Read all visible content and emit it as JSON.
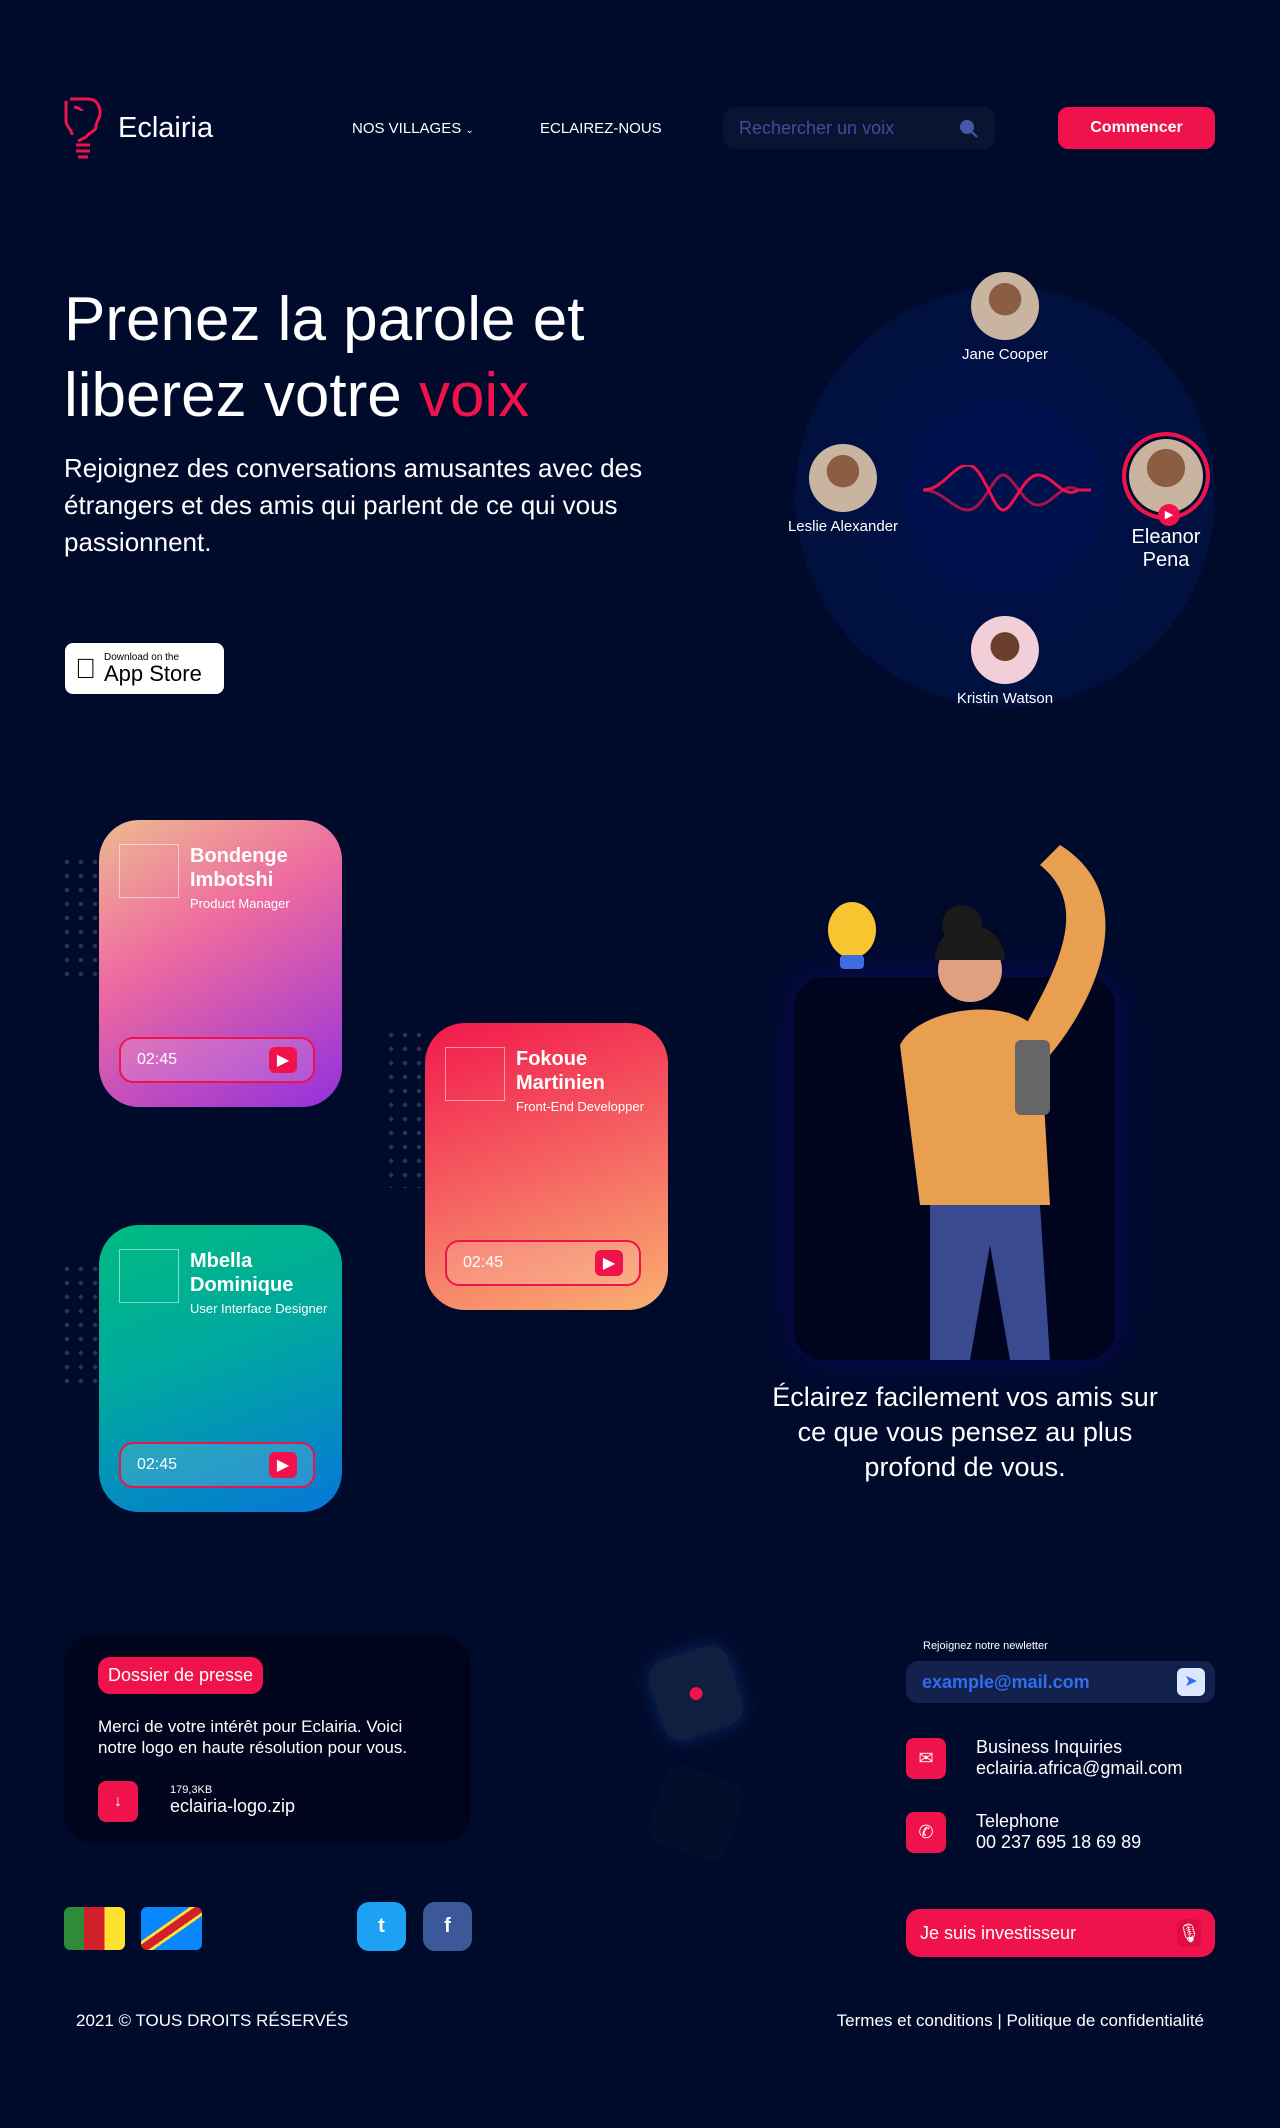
{
  "header": {
    "brand": "Eclairia",
    "nav": [
      {
        "label": "NOS VILLAGES"
      },
      {
        "label": "ECLAIREZ-NOUS"
      }
    ],
    "search_placeholder": "Rechercher un voix",
    "cta": "Commencer"
  },
  "hero": {
    "title_part1": "Prenez la parole et liberez votre ",
    "title_accent": "voix",
    "subtitle": "Rejoignez des conversations amusantes avec des étrangers et des amis qui parlent de ce qui vous passionnent.",
    "appstore_small": "Download on the",
    "appstore_big": "App Store"
  },
  "speakers": [
    {
      "name": "Jane Cooper"
    },
    {
      "name": "Leslie Alexander"
    },
    {
      "name": "Eleanor Pena",
      "active": true
    },
    {
      "name": "Kristin Watson"
    }
  ],
  "cards": [
    {
      "name": "Bondenge Imbotshi",
      "role": "Product Manager",
      "duration": "02:45"
    },
    {
      "name": "Fokoue Martinien",
      "role": "Front-End Developper",
      "duration": "02:45"
    },
    {
      "name": "Mbella Dominique",
      "role": "User Interface Designer",
      "duration": "02:45"
    }
  ],
  "feature": {
    "caption": "Éclairez facilement vos amis sur ce que vous pensez au plus profond de vous."
  },
  "press": {
    "badge": "Dossier de presse",
    "text": "Merci de votre intérêt pour Eclairia. Voici notre logo en haute résolution pour vous.",
    "file_size": "179,3KB",
    "file_name": "eclairia-logo.zip"
  },
  "newsletter": {
    "label": "Rejoignez notre newletter",
    "placeholder": "example@mail.com"
  },
  "contacts": [
    {
      "title": "Business Inquiries",
      "value": "eclairia.africa@gmail.com"
    },
    {
      "title": "Telephone",
      "value": "00 237 695 18 69 89"
    }
  ],
  "investor_button": "Je suis investisseur",
  "footer": {
    "copyright": "2021 © TOUS DROITS RÉSERVÉS",
    "terms": "Termes et conditions",
    "separator": "|",
    "privacy": "Politique de confidentialité"
  },
  "colors": {
    "accent": "#f0124a",
    "background": "#000a2b"
  }
}
